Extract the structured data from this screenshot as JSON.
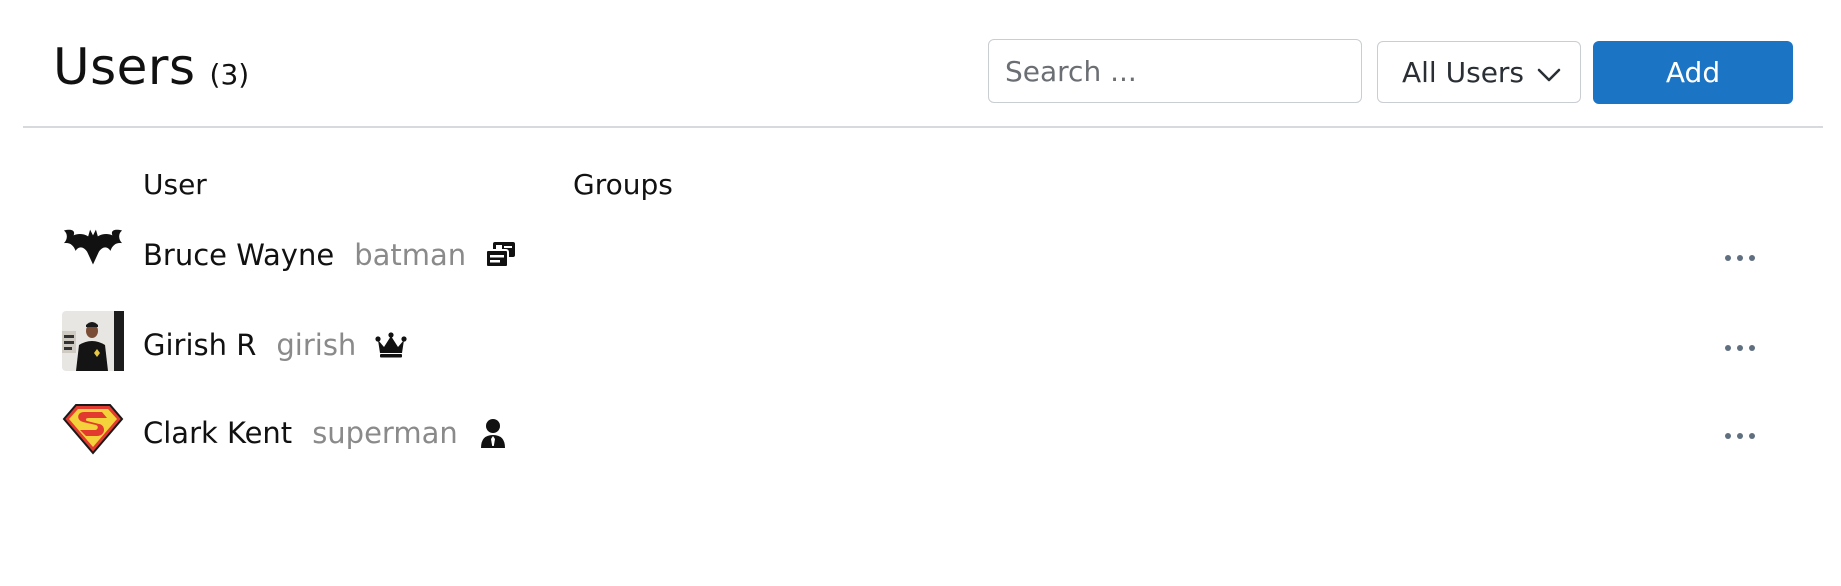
{
  "header": {
    "title": "Users",
    "count": "(3)",
    "search_placeholder": "Search ...",
    "filter_label": "All Users",
    "add_label": "Add"
  },
  "columns": {
    "user": "User",
    "groups": "Groups"
  },
  "users": [
    {
      "name": "Bruce Wayne",
      "handle": "batman",
      "avatar_icon": "bat-logo-icon",
      "role_icon": "admin-id-card-icon"
    },
    {
      "name": "Girish R",
      "handle": "girish",
      "avatar_icon": "profile-photo",
      "role_icon": "crown-icon"
    },
    {
      "name": "Clark Kent",
      "handle": "superman",
      "avatar_icon": "superman-logo-icon",
      "role_icon": "user-tie-icon"
    }
  ],
  "colors": {
    "accent": "#1b74c4",
    "muted_text": "#8a8a8a",
    "divider": "#d7dadd",
    "more_dots": "#5f6f80"
  }
}
